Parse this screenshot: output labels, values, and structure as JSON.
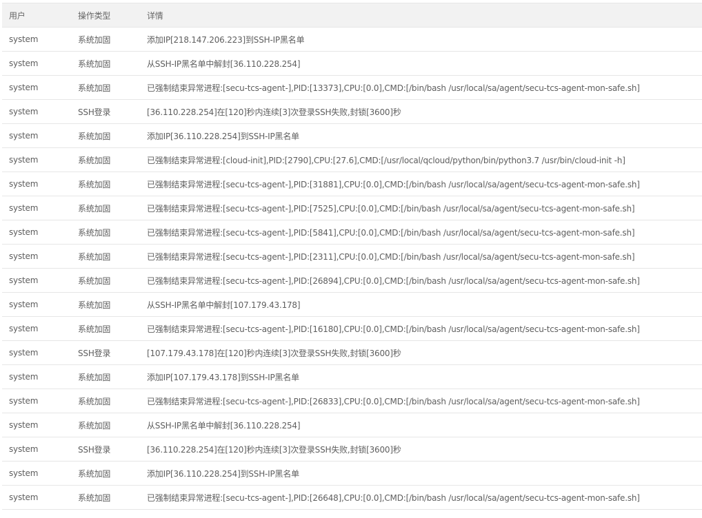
{
  "table": {
    "headers": [
      "用户",
      "操作类型",
      "详情"
    ],
    "rows": [
      {
        "user": "system",
        "type": "系统加固",
        "detail": "添加IP[218.147.206.223]到SSH-IP黑名单"
      },
      {
        "user": "system",
        "type": "系统加固",
        "detail": "从SSH-IP黑名单中解封[36.110.228.254]"
      },
      {
        "user": "system",
        "type": "系统加固",
        "detail": "已强制结束异常进程:[secu-tcs-agent-],PID:[13373],CPU:[0.0],CMD:[/bin/bash /usr/local/sa/agent/secu-tcs-agent-mon-safe.sh]"
      },
      {
        "user": "system",
        "type": "SSH登录",
        "detail": "[36.110.228.254]在[120]秒内连续[3]次登录SSH失败,封锁[3600]秒"
      },
      {
        "user": "system",
        "type": "系统加固",
        "detail": "添加IP[36.110.228.254]到SSH-IP黑名单"
      },
      {
        "user": "system",
        "type": "系统加固",
        "detail": "已强制结束异常进程:[cloud-init],PID:[2790],CPU:[27.6],CMD:[/usr/local/qcloud/python/bin/python3.7 /usr/bin/cloud-init -h]"
      },
      {
        "user": "system",
        "type": "系统加固",
        "detail": "已强制结束异常进程:[secu-tcs-agent-],PID:[31881],CPU:[0.0],CMD:[/bin/bash /usr/local/sa/agent/secu-tcs-agent-mon-safe.sh]"
      },
      {
        "user": "system",
        "type": "系统加固",
        "detail": "已强制结束异常进程:[secu-tcs-agent-],PID:[7525],CPU:[0.0],CMD:[/bin/bash /usr/local/sa/agent/secu-tcs-agent-mon-safe.sh]"
      },
      {
        "user": "system",
        "type": "系统加固",
        "detail": "已强制结束异常进程:[secu-tcs-agent-],PID:[5841],CPU:[0.0],CMD:[/bin/bash /usr/local/sa/agent/secu-tcs-agent-mon-safe.sh]"
      },
      {
        "user": "system",
        "type": "系统加固",
        "detail": "已强制结束异常进程:[secu-tcs-agent-],PID:[2311],CPU:[0.0],CMD:[/bin/bash /usr/local/sa/agent/secu-tcs-agent-mon-safe.sh]"
      },
      {
        "user": "system",
        "type": "系统加固",
        "detail": "已强制结束异常进程:[secu-tcs-agent-],PID:[26894],CPU:[0.0],CMD:[/bin/bash /usr/local/sa/agent/secu-tcs-agent-mon-safe.sh]"
      },
      {
        "user": "system",
        "type": "系统加固",
        "detail": "从SSH-IP黑名单中解封[107.179.43.178]"
      },
      {
        "user": "system",
        "type": "系统加固",
        "detail": "已强制结束异常进程:[secu-tcs-agent-],PID:[16180],CPU:[0.0],CMD:[/bin/bash /usr/local/sa/agent/secu-tcs-agent-mon-safe.sh]"
      },
      {
        "user": "system",
        "type": "SSH登录",
        "detail": "[107.179.43.178]在[120]秒内连续[3]次登录SSH失败,封锁[3600]秒"
      },
      {
        "user": "system",
        "type": "系统加固",
        "detail": "添加IP[107.179.43.178]到SSH-IP黑名单"
      },
      {
        "user": "system",
        "type": "系统加固",
        "detail": "已强制结束异常进程:[secu-tcs-agent-],PID:[26833],CPU:[0.0],CMD:[/bin/bash /usr/local/sa/agent/secu-tcs-agent-mon-safe.sh]"
      },
      {
        "user": "system",
        "type": "系统加固",
        "detail": "从SSH-IP黑名单中解封[36.110.228.254]"
      },
      {
        "user": "system",
        "type": "SSH登录",
        "detail": "[36.110.228.254]在[120]秒内连续[3]次登录SSH失败,封锁[3600]秒"
      },
      {
        "user": "system",
        "type": "系统加固",
        "detail": "添加IP[36.110.228.254]到SSH-IP黑名单"
      },
      {
        "user": "system",
        "type": "系统加固",
        "detail": "已强制结束异常进程:[secu-tcs-agent-],PID:[26648],CPU:[0.0],CMD:[/bin/bash /usr/local/sa/agent/secu-tcs-agent-mon-safe.sh]"
      }
    ]
  }
}
